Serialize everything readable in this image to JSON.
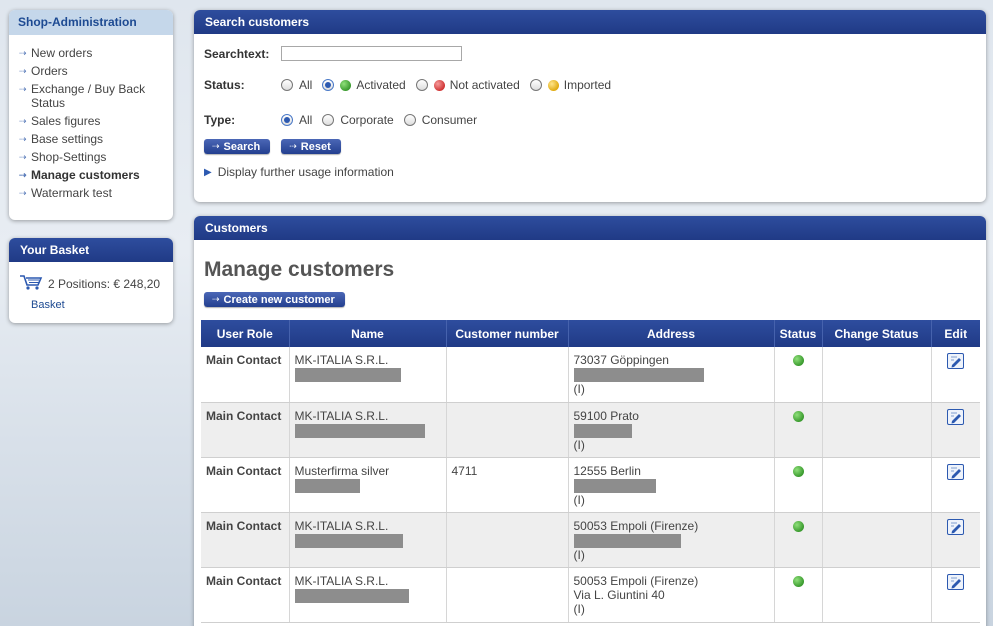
{
  "sidebar": {
    "title": "Shop-Administration",
    "items": [
      {
        "label": "New orders"
      },
      {
        "label": "Orders"
      },
      {
        "label": "Exchange / Buy Back Status"
      },
      {
        "label": "Sales figures"
      },
      {
        "label": "Base settings"
      },
      {
        "label": "Shop-Settings"
      },
      {
        "label": "Manage customers"
      },
      {
        "label": "Watermark test"
      }
    ]
  },
  "basket": {
    "title": "Your Basket",
    "summary": "2 Positions: € 248,20",
    "link": "Basket"
  },
  "search": {
    "title": "Search customers",
    "searchtext_label": "Searchtext:",
    "searchtext_value": "",
    "status_label": "Status:",
    "status_options": [
      {
        "label": "All",
        "checked": false
      },
      {
        "label": "Activated",
        "checked": true,
        "color": "#4caf3f"
      },
      {
        "label": "Not activated",
        "checked": false,
        "color": "#e04b4b"
      },
      {
        "label": "Imported",
        "checked": false,
        "color": "#f2c21c"
      }
    ],
    "type_label": "Type:",
    "type_options": [
      {
        "label": "All",
        "checked": true
      },
      {
        "label": "Corporate",
        "checked": false
      },
      {
        "label": "Consumer",
        "checked": false
      }
    ],
    "search_button": "Search",
    "reset_button": "Reset",
    "info_toggle": "Display further usage information"
  },
  "customers": {
    "title": "Customers",
    "heading": "Manage customers",
    "create_button": "Create new customer",
    "columns": [
      "User Role",
      "Name",
      "Customer number",
      "Address",
      "Status",
      "Change Status",
      "Edit"
    ],
    "rows": [
      {
        "role": "Main Contact",
        "name": "MK-ITALIA S.R.L.",
        "number": "",
        "address": [
          "73037 Göppingen",
          "",
          "(I)"
        ],
        "status": "active"
      },
      {
        "role": "Main Contact",
        "name": "MK-ITALIA S.R.L.",
        "number": "",
        "address": [
          "59100 Prato",
          "",
          "(I)"
        ],
        "status": "active"
      },
      {
        "role": "Main Contact",
        "name": "Musterfirma silver",
        "number": "4711",
        "address": [
          "12555 Berlin",
          "",
          "(I)"
        ],
        "status": "active"
      },
      {
        "role": "Main Contact",
        "name": "MK-ITALIA S.R.L.",
        "number": "",
        "address": [
          "50053 Empoli (Firenze)",
          "",
          "(I)"
        ],
        "status": "active"
      },
      {
        "role": "Main Contact",
        "name": "MK-ITALIA S.R.L.",
        "number": "",
        "address": [
          "50053 Empoli (Firenze)",
          "Via L. Giuntini 40",
          "(I)"
        ],
        "status": "active"
      }
    ]
  },
  "colors": {
    "header_blue": "#2a4798",
    "sidebar_header_bg": "#c5d7ea",
    "status_active": "#4caf3f"
  }
}
